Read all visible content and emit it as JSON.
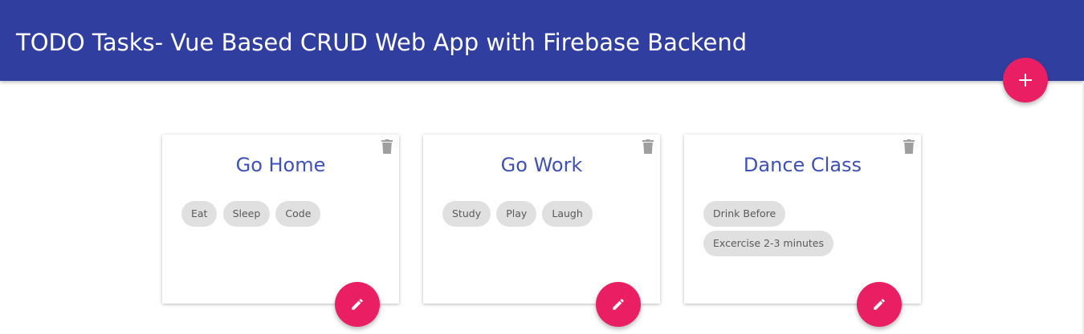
{
  "header": {
    "title": "TODO Tasks- Vue Based CRUD Web App with Firebase Backend"
  },
  "colors": {
    "primary": "#303f9f",
    "accent": "#e91e63",
    "card_title": "#3f51b5",
    "chip_bg": "#e0e0e0"
  },
  "add_button": {
    "icon": "plus-icon"
  },
  "cards": [
    {
      "title": "Go Home",
      "chips": [
        "Eat",
        "Sleep",
        "Code"
      ],
      "delete_icon": "trash-icon",
      "edit_icon": "pencil-icon"
    },
    {
      "title": "Go Work",
      "chips": [
        "Study",
        "Play",
        "Laugh"
      ],
      "delete_icon": "trash-icon",
      "edit_icon": "pencil-icon"
    },
    {
      "title": "Dance Class",
      "chips": [
        "Drink Before",
        "Excercise 2-3 minutes"
      ],
      "delete_icon": "trash-icon",
      "edit_icon": "pencil-icon"
    }
  ]
}
